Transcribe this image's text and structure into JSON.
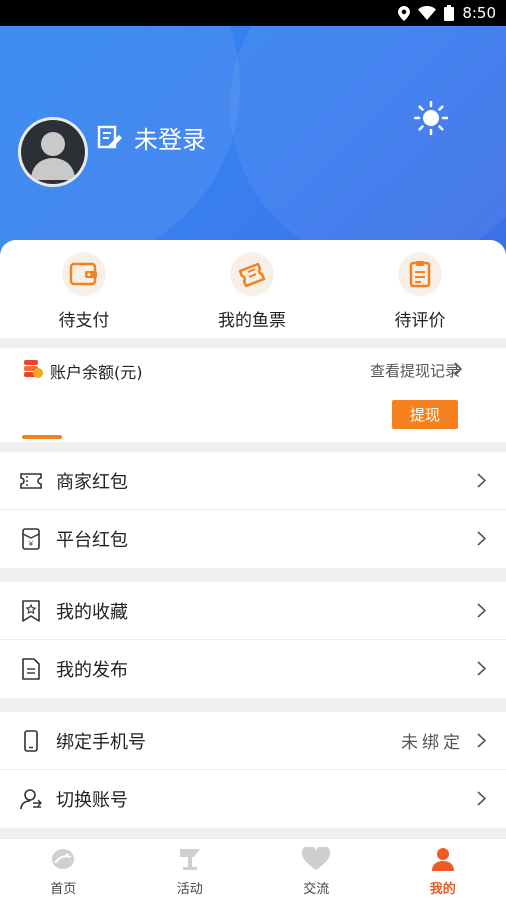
{
  "status_bar": {
    "time": "8:50"
  },
  "profile": {
    "login_label": "未登录"
  },
  "quick_actions": [
    {
      "label": "待支付",
      "icon": "wallet-icon"
    },
    {
      "label": "我的鱼票",
      "icon": "ticket-icon"
    },
    {
      "label": "待评价",
      "icon": "review-icon"
    }
  ],
  "balance": {
    "title": "账户余额(元)",
    "history_link": "查看提现记录",
    "withdraw_label": "提现"
  },
  "menu_groups": [
    [
      {
        "label": "商家红包",
        "icon": "coupon-icon"
      },
      {
        "label": "平台红包",
        "icon": "red-packet-icon"
      }
    ],
    [
      {
        "label": "我的收藏",
        "icon": "bookmark-star-icon"
      },
      {
        "label": "我的发布",
        "icon": "document-icon"
      }
    ],
    [
      {
        "label": "绑定手机号",
        "icon": "phone-icon",
        "value": "未绑定"
      },
      {
        "label": "切换账号",
        "icon": "switch-user-icon"
      }
    ]
  ],
  "tabs": [
    {
      "label": "首页",
      "icon": "home-fish-icon",
      "active": false
    },
    {
      "label": "活动",
      "icon": "activity-icon",
      "active": false
    },
    {
      "label": "交流",
      "icon": "heart-icon",
      "active": false
    },
    {
      "label": "我的",
      "icon": "user-icon",
      "active": true
    }
  ],
  "colors": {
    "accent": "#f5811e",
    "header_blue": "#3a7ef0",
    "tab_active": "#f05a24"
  }
}
